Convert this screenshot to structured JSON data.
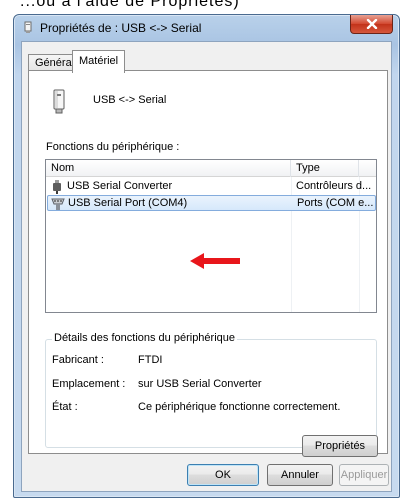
{
  "background_fragment": "...ou a l'aide de Propriétés)",
  "window": {
    "title": "Propriétés de : USB <-> Serial",
    "close_icon": "close-x-icon"
  },
  "tabs": [
    {
      "label": "Général",
      "active": false
    },
    {
      "label": "Matériel",
      "active": true
    }
  ],
  "device": {
    "name": "USB <-> Serial",
    "icon": "usb-device-icon"
  },
  "functions_label": "Fonctions du périphérique :",
  "list": {
    "columns": {
      "name": "Nom",
      "type": "Type"
    },
    "rows": [
      {
        "name": "USB Serial Converter",
        "type": "Contrôleurs d...",
        "icon": "usb-plug-icon",
        "selected": false
      },
      {
        "name": "USB Serial Port (COM4)",
        "type": "Ports (COM e...",
        "icon": "serial-port-icon",
        "selected": true
      }
    ]
  },
  "annotation": {
    "icon": "red-arrow-icon",
    "color": "#e8161b"
  },
  "details": {
    "title": "Détails des fonctions du périphérique",
    "manufacturer_label": "Fabricant :",
    "manufacturer_value": "FTDI",
    "location_label": "Emplacement :",
    "location_value": "sur USB Serial Converter",
    "status_label": "État :",
    "status_value": "Ce périphérique fonctionne correctement.",
    "properties_button": "Propriétés"
  },
  "buttons": {
    "ok": "OK",
    "cancel": "Annuler",
    "apply": "Appliquer"
  }
}
